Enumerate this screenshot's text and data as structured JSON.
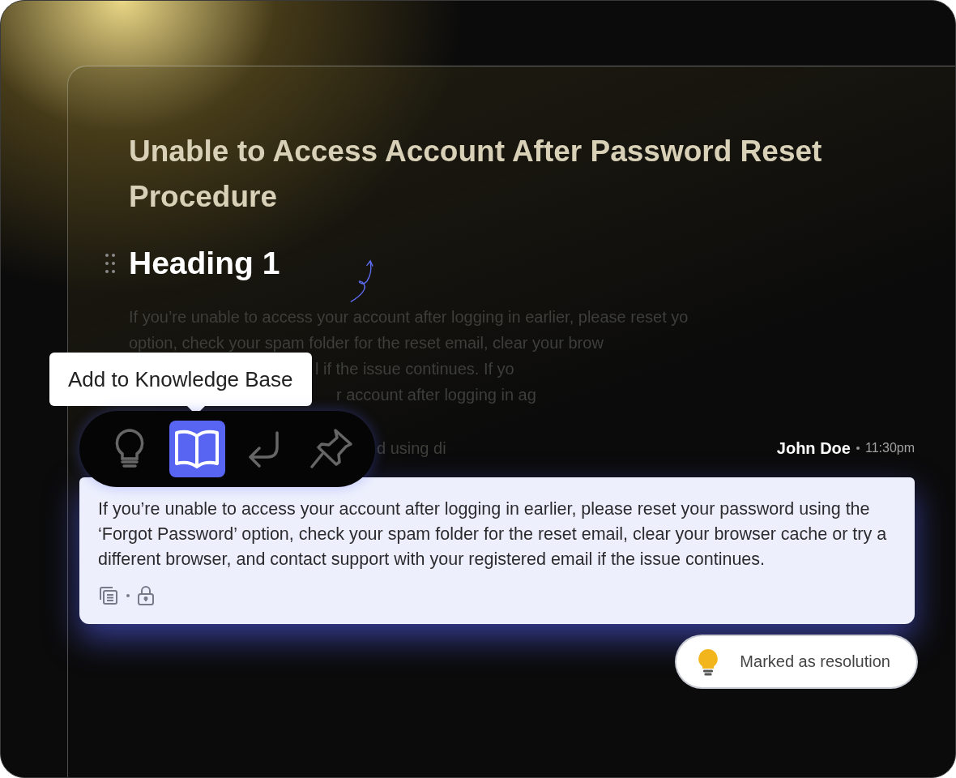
{
  "document": {
    "title": "Unable to Access Account After Password Reset Procedure",
    "heading": "Heading 1",
    "faded_lines": [
      "If you’re unable to access your account after logging in earlier, please reset yo",
      "option, check your spam folder for the reset email, clear your brow",
      "l if the issue continues. If yo",
      "r account after logging in ag",
      "d using di"
    ]
  },
  "tooltip": "Add to Knowledge Base",
  "toolbar": [
    {
      "kind": "bulb",
      "selected": false
    },
    {
      "kind": "book",
      "selected": true
    },
    {
      "kind": "return",
      "selected": false
    },
    {
      "kind": "pin",
      "selected": false
    }
  ],
  "message": {
    "author": "John Doe",
    "time": "11:30pm",
    "text": "If you’re unable to access your account after logging in earlier, please reset your password using the ‘Forgot Password’ option, check your spam folder for the reset email, clear your browser cache or try a different browser, and contact support with your registered email if the issue continues."
  },
  "badge": "Marked as resolution"
}
